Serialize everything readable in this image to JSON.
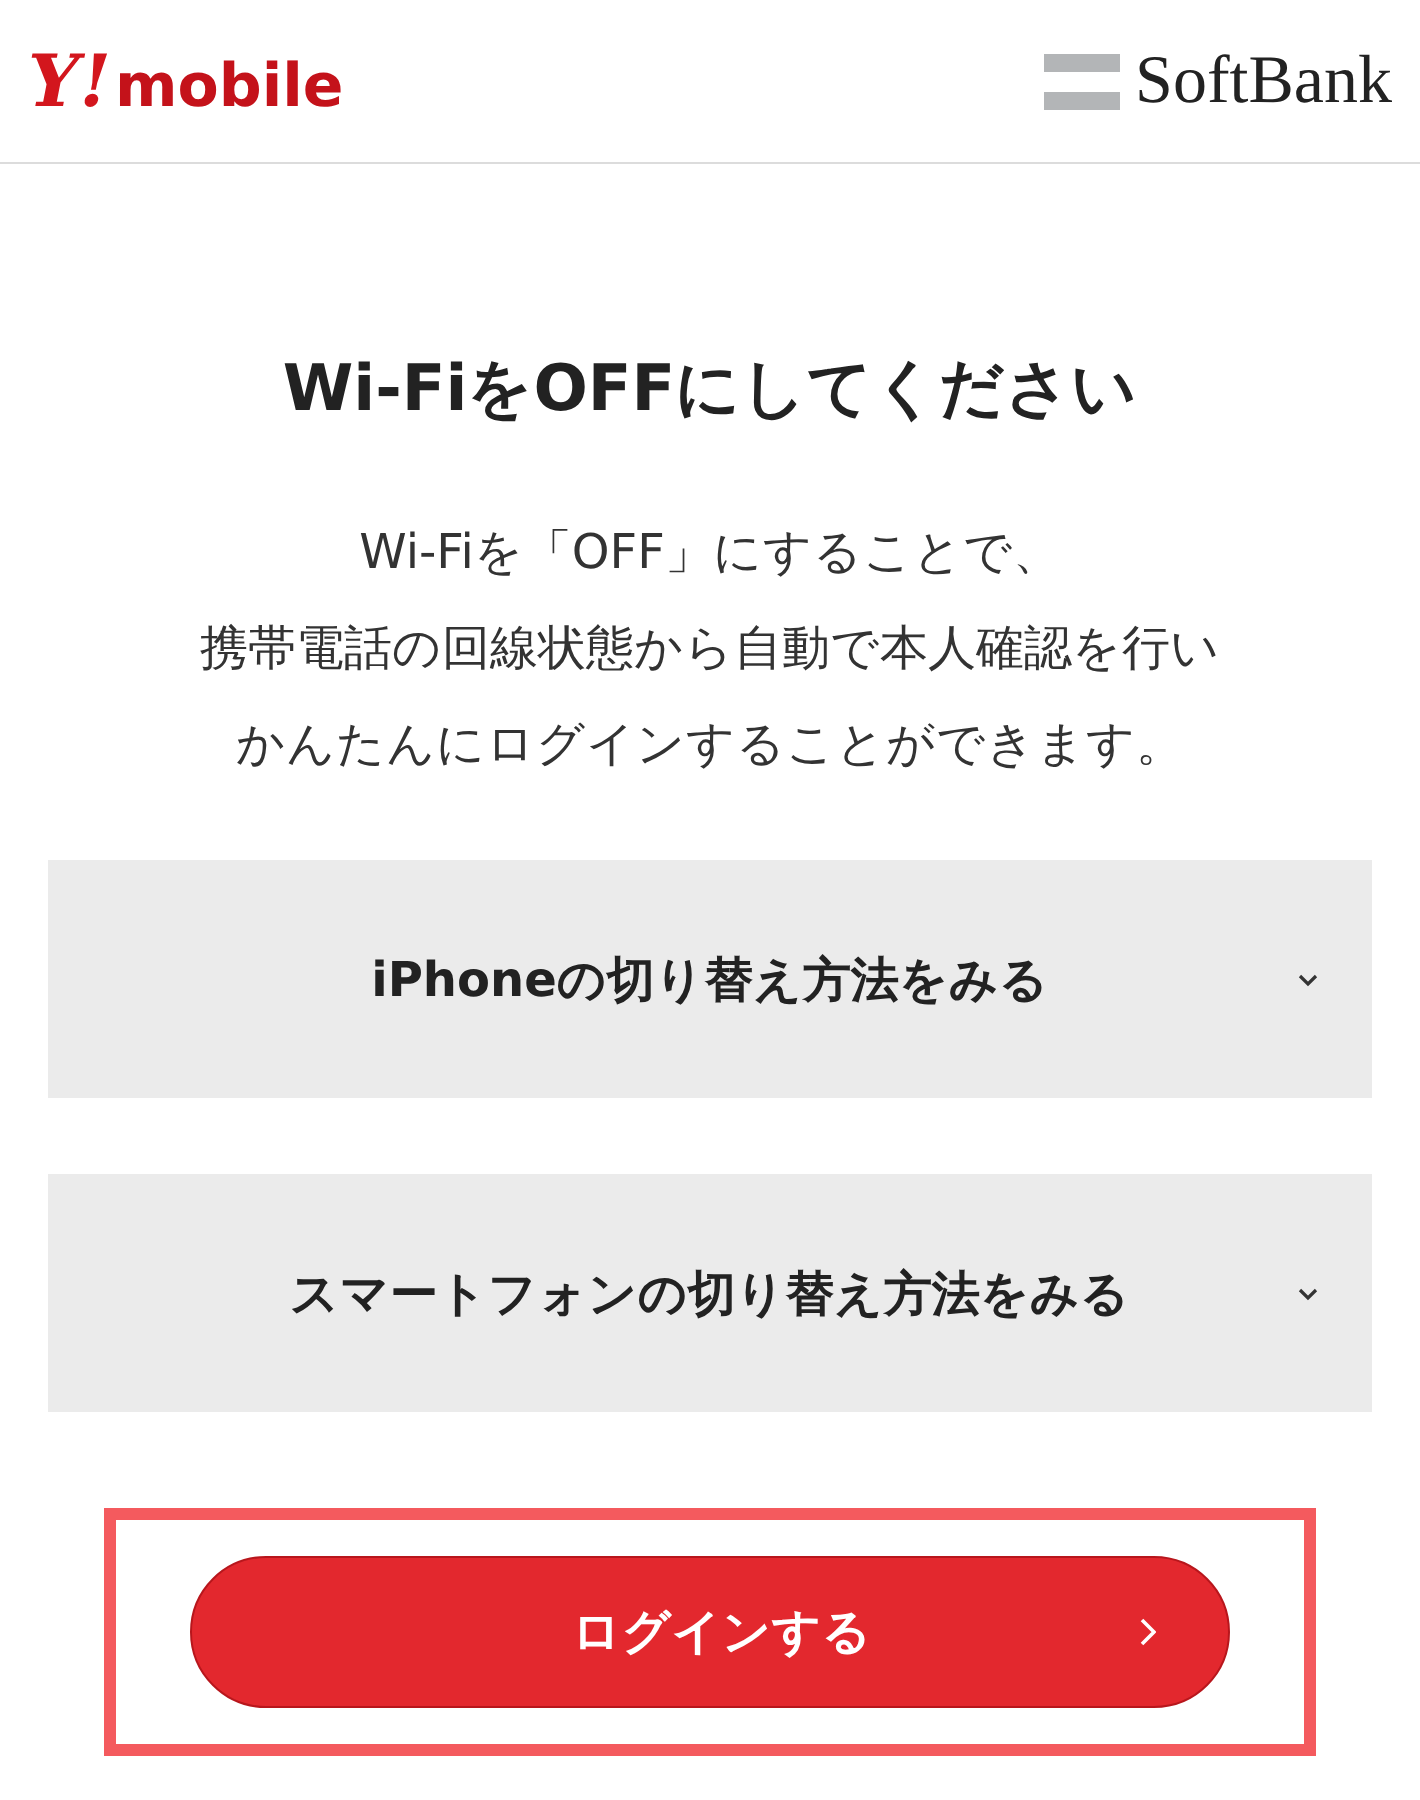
{
  "header": {
    "brand_left": {
      "mark": "Y!",
      "word": "mobile"
    },
    "brand_right": "SoftBank"
  },
  "title": "Wi-FiをOFFにしてください",
  "description": [
    "Wi-Fiを「OFF」にすることで、",
    "携帯電話の回線状態から自動で本人確認を行い",
    "かんたんにログインすることができます。"
  ],
  "accordions": [
    {
      "label": "iPhoneの切り替え方法をみる",
      "expanded": false
    },
    {
      "label": "スマートフォンの切り替え方法をみる",
      "expanded": false
    }
  ],
  "login_button": {
    "label": "ログインする",
    "highlighted": true
  }
}
